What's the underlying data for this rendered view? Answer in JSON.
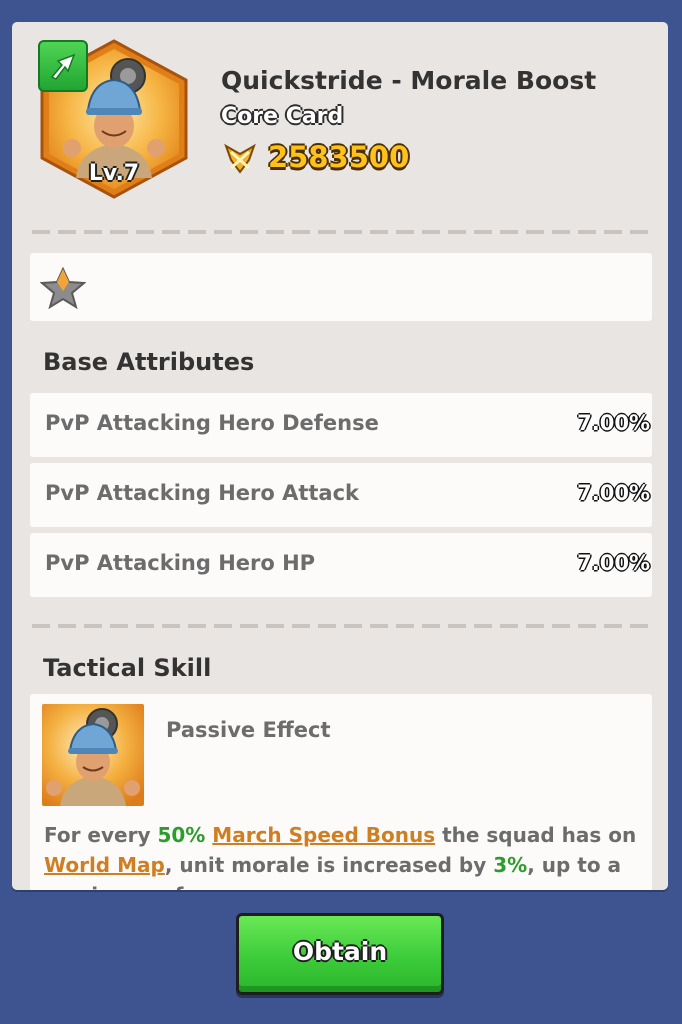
{
  "header": {
    "card_name": "Quickstride - Morale Boost",
    "card_type": "Core Card",
    "level": "Lv.7",
    "power": "2583500",
    "upgrade_icon": "upgrade-arrow-icon",
    "power_icon": "crossed-swords-icon"
  },
  "rating": {
    "star_icon": "star-icon",
    "filled_stars": 0.5
  },
  "base_attributes": {
    "title": "Base Attributes",
    "rows": [
      {
        "name": "PvP  Attacking Hero Defense",
        "value": "7.00%"
      },
      {
        "name": "PvP  Attacking Hero Attack",
        "value": "7.00%"
      },
      {
        "name": "PvP  Attacking Hero HP",
        "value": "7.00%"
      }
    ]
  },
  "tactical_skill": {
    "title": "Tactical Skill",
    "effect_label": "Passive Effect",
    "desc": {
      "p1": "For every ",
      "v1": "50%",
      "p2": " ",
      "k1": "March Speed Bonus",
      "p3": " the squad has on ",
      "k2": "World Map",
      "p4": ", unit morale is increased by ",
      "v2": "3%",
      "p5": ", up to a maximum of"
    }
  },
  "actions": {
    "obtain_label": "Obtain"
  },
  "colors": {
    "background": "#3d5491",
    "panel": "#e9e5e2",
    "power_gold": "#ffc11c",
    "green_highlight": "#2d9c2d",
    "orange_keyword": "#cf7f21",
    "button_green": "#3ccc3a"
  }
}
